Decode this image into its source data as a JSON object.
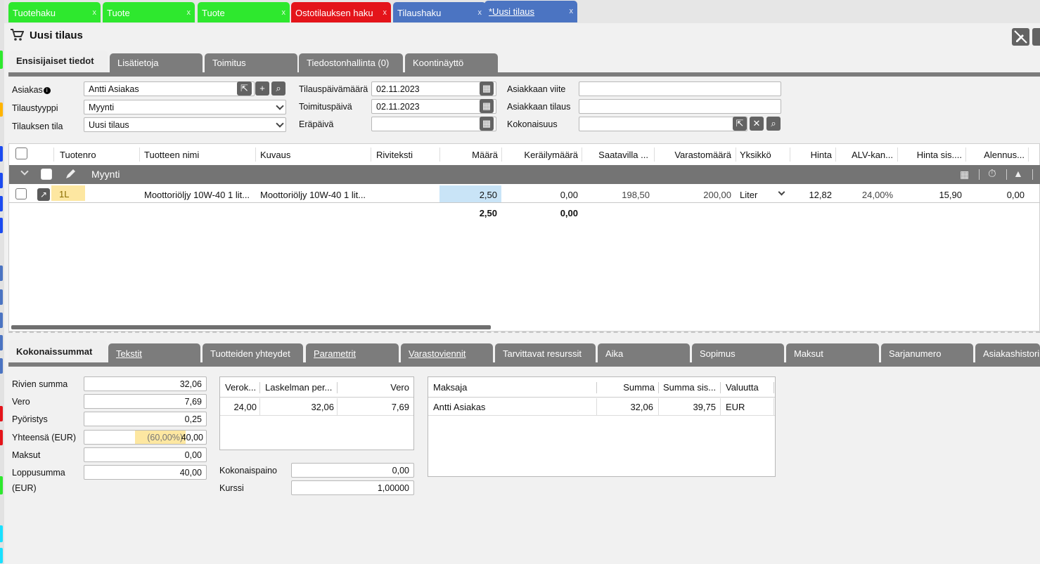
{
  "top_tabs": [
    {
      "label": "Tuotehaku",
      "close": "x"
    },
    {
      "label": "Tuote",
      "close": "x"
    },
    {
      "label": "Tuote",
      "close": "x"
    },
    {
      "label": "Ostotilauksen haku",
      "close": "x"
    },
    {
      "label": "Tilaushaku",
      "close": "x"
    },
    {
      "label": "*Uusi tilaus",
      "close": "x"
    }
  ],
  "title": "Uusi tilaus",
  "main_tabs": [
    "Ensisijaiset tiedot",
    "Lisätietoja",
    "Toimitus",
    "Tiedostonhallinta (0)",
    "Koontinäyttö"
  ],
  "form": {
    "asiakas_label": "Asiakas",
    "asiakas_value": "Antti Asiakas",
    "tilaustyyppi_label": "Tilaustyyppi",
    "tilaustyyppi_value": "Myynti",
    "tila_label": "Tilauksen tila",
    "tila_value": "Uusi tilaus",
    "tilauspvm_label": "Tilauspäivämäärä",
    "tilauspvm_value": "02.11.2023",
    "toimituspvm_label": "Toimituspäivä",
    "toimituspvm_value": "02.11.2023",
    "erapaiva_label": "Eräpäivä",
    "erapaiva_value": "",
    "viite_label": "Asiakkaan viite",
    "viite_value": "",
    "astilaus_label": "Asiakkaan tilaus",
    "astilaus_value": "",
    "kokonaisuus_label": "Kokonaisuus",
    "kokonaisuus_value": ""
  },
  "grid": {
    "headers": [
      "Tuotenro",
      "Tuotteen nimi",
      "Kuvaus",
      "Riviteksti",
      "Määrä",
      "Keräilymäärä",
      "Saatavilla ...",
      "Varastomäärä",
      "Yksikkö",
      "Hinta",
      "ALV-kan...",
      "Hinta sis....",
      "Alennus..."
    ],
    "group": "Myynti",
    "row": {
      "tuotenro": "1L",
      "nimi": "Moottoriöljy 10W-40 1 lit...",
      "kuvaus": "Moottoriöljy 10W-40 1 lit...",
      "riviteksti": "",
      "maara": "2,50",
      "kerailymaara": "0,00",
      "saatavilla": "198,50",
      "varastomaara": "200,00",
      "yksikko": "Liter",
      "hinta": "12,82",
      "alv": "24,00%",
      "hinta_sis": "15,90",
      "alennus": "0,00"
    },
    "totals": {
      "maara": "2,50",
      "kerailymaara": "0,00"
    }
  },
  "bottom_tabs": [
    "Kokonaissummat",
    "Tekstit",
    "Tuotteiden yhteydet",
    "Parametrit",
    "Varastoviennit",
    "Tarvittavat resurssit",
    "Aika",
    "Sopimus",
    "Maksut",
    "Sarjanumero",
    "Asiakashistori"
  ],
  "summary": {
    "rivien_label": "Rivien summa",
    "rivien": "32,06",
    "vero_label": "Vero",
    "vero": "7,69",
    "pyoristys_label": "Pyöristys",
    "pyoristys": "0,25",
    "yhteensa_label": "Yhteensä (EUR)",
    "yhteensa": "40,00",
    "yhteensa_pct": "(60,00%)",
    "maksut_label": "Maksut",
    "maksut": "0,00",
    "loppu_label1": "Loppusumma",
    "loppu_label2": "(EUR)",
    "loppu": "40,00"
  },
  "vat_table": {
    "headers": [
      "Verok...",
      "Laskelman per...",
      "Vero"
    ],
    "row": [
      "24,00",
      "32,06",
      "7,69"
    ]
  },
  "weight": {
    "paino_label": "Kokonaispaino",
    "paino": "0,00",
    "kurssi_label": "Kurssi",
    "kurssi": "1,00000"
  },
  "payer_table": {
    "headers": [
      "Maksaja",
      "Summa",
      "Summa sis...",
      "Valuutta"
    ],
    "row": [
      "Antti Asiakas",
      "32,06",
      "39,75",
      "EUR"
    ]
  },
  "colors": {
    "green": "#2ee82e",
    "red": "#e4141a",
    "blue": "#4b74c2",
    "tab_gray": "#7c7c7c",
    "highlight": "#fde7a1",
    "qty_bg": "#c9e4f7"
  }
}
